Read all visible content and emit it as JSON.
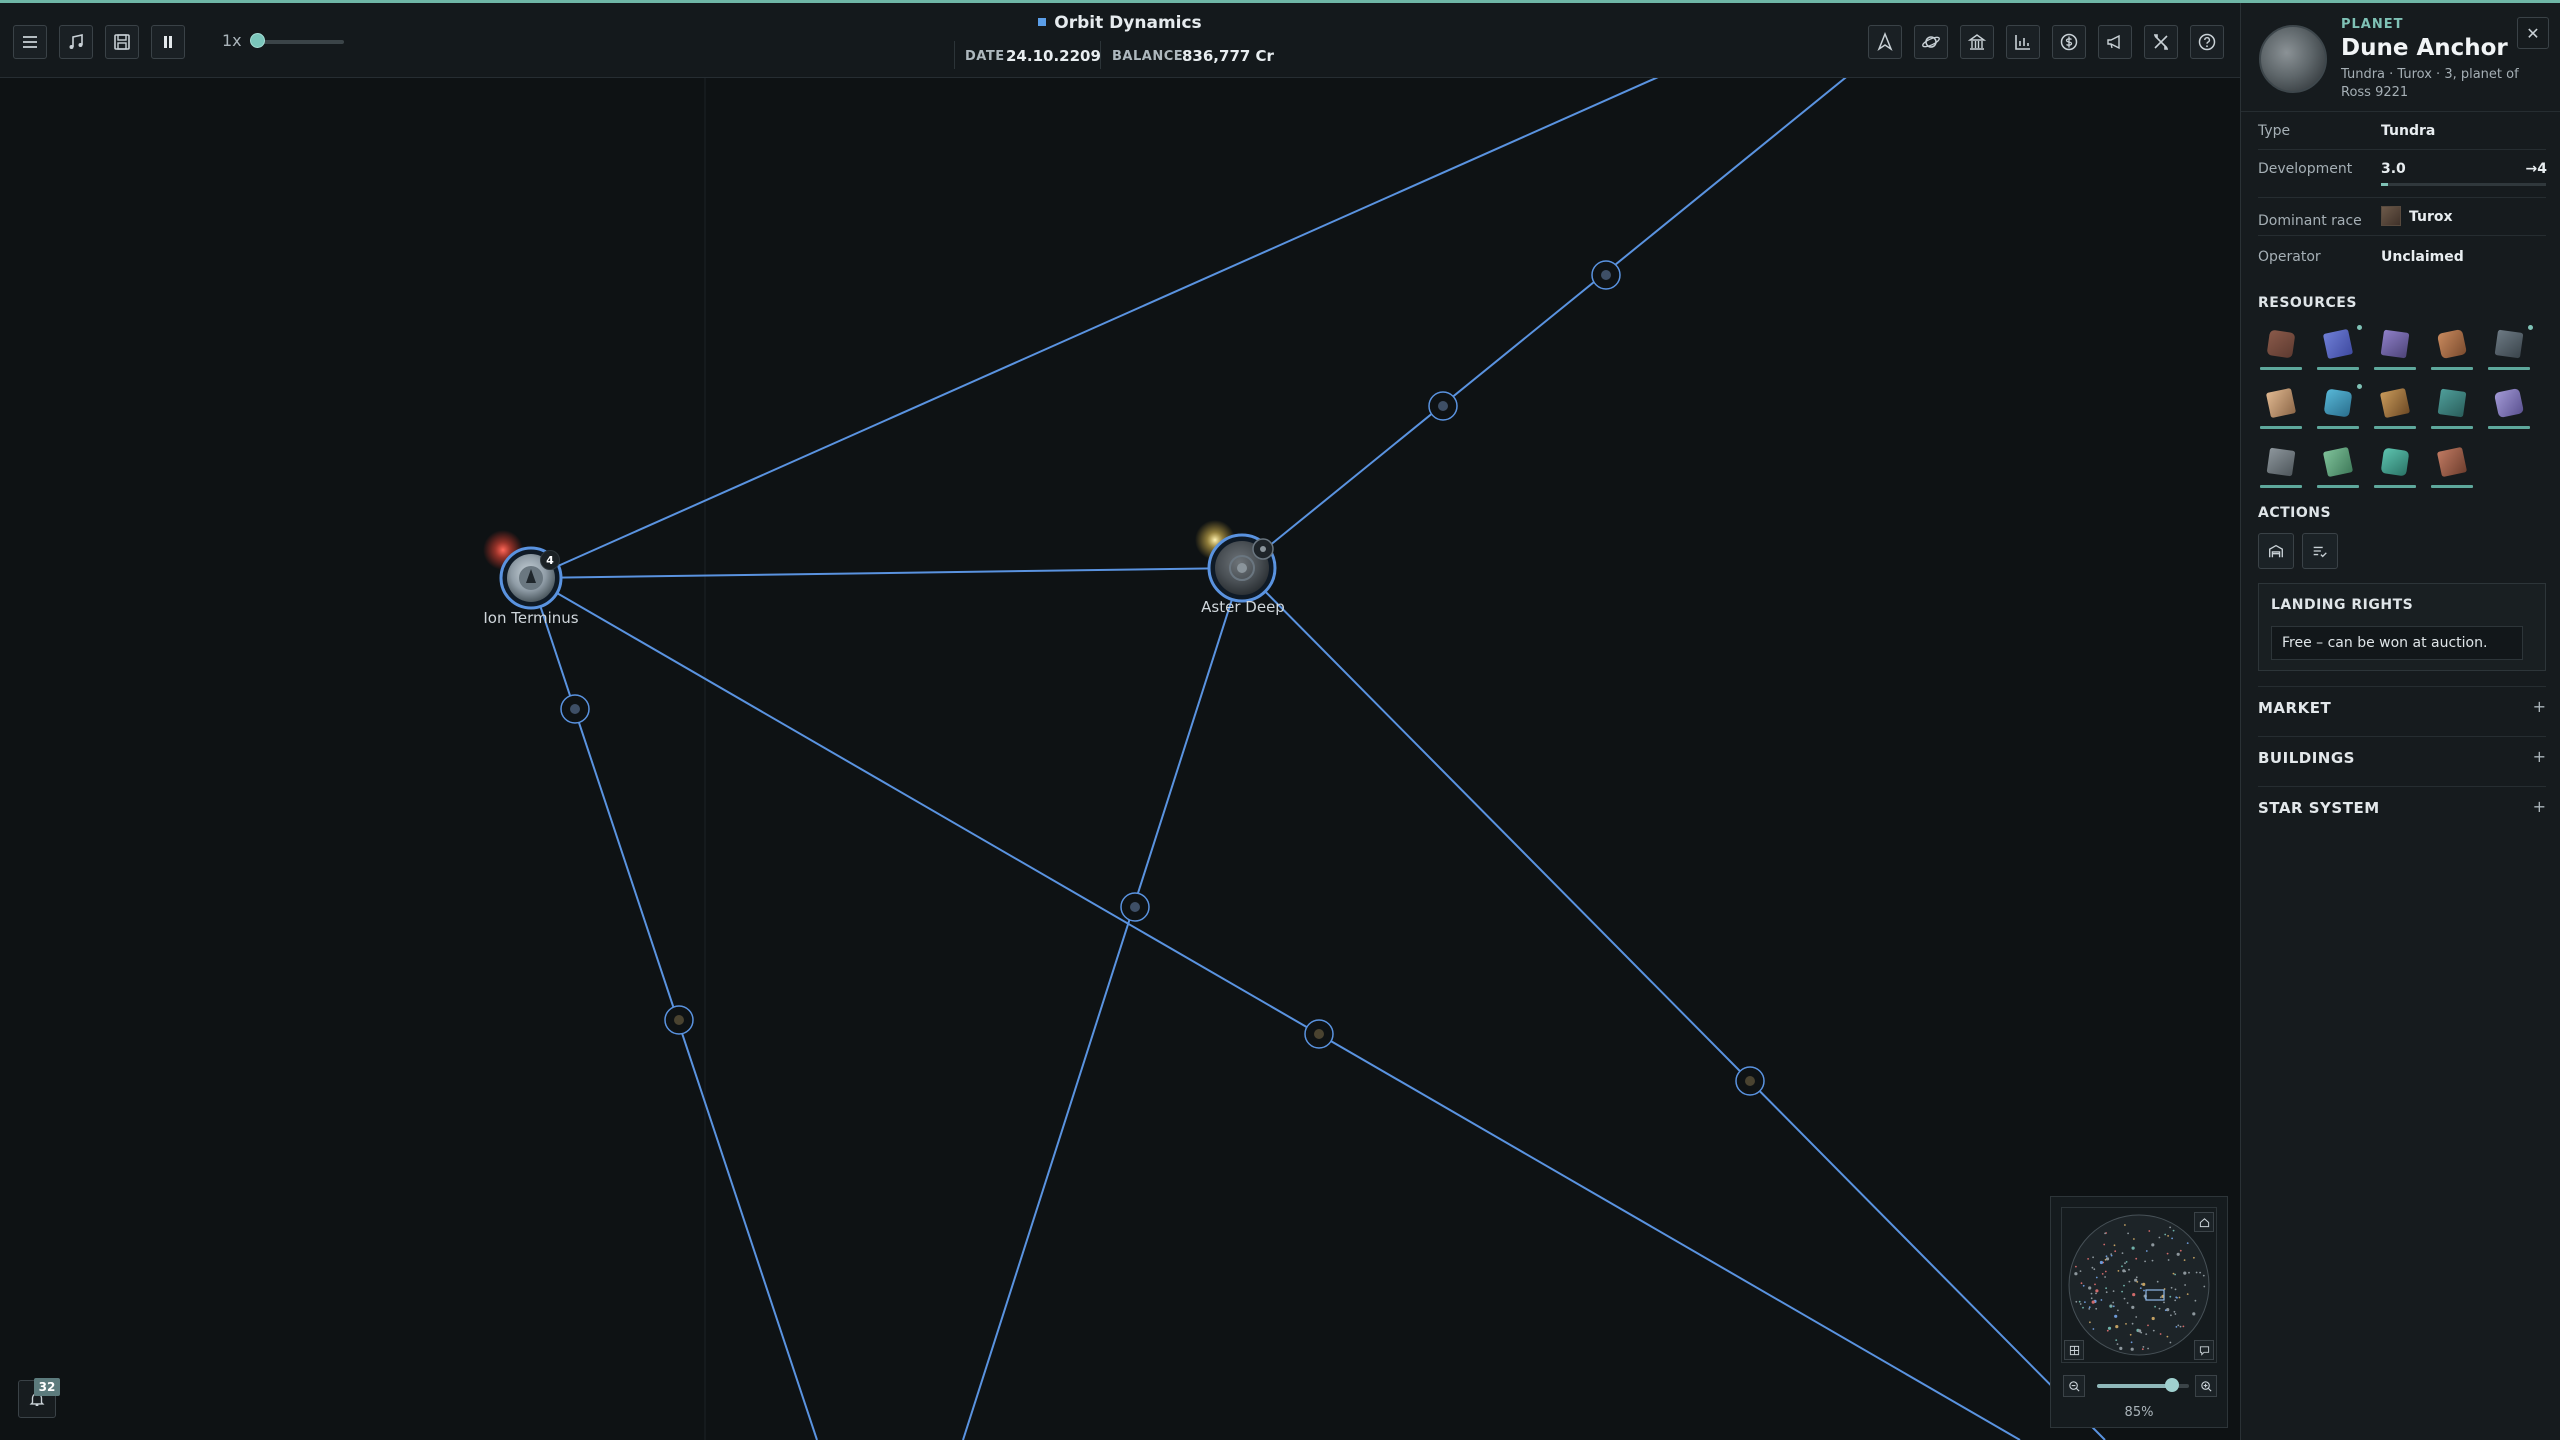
{
  "topbar": {
    "company": "Orbit Dynamics",
    "speed": "1x",
    "date_label": "DATE",
    "date_value": "24.10.2209",
    "balance_label": "BALANCE",
    "balance_value": "836,777 Cr",
    "left_buttons": [
      "menu-icon",
      "music-icon",
      "save-icon",
      "pause-icon"
    ],
    "right_buttons": [
      "ship-icon",
      "planet-icon",
      "bank-icon",
      "chart-icon",
      "money-icon",
      "megaphone-icon",
      "tools-icon",
      "help-icon"
    ]
  },
  "map": {
    "planets": [
      {
        "name": "Ion Terminus",
        "badge": "4"
      },
      {
        "name": "Aster Deep"
      }
    ]
  },
  "notifications": {
    "count": "32"
  },
  "minimap": {
    "zoom": "85%",
    "zoom_fraction": 0.82
  },
  "panel": {
    "kind": "PLANET",
    "name": "Dune Anchor",
    "subtitle": "Tundra · Turox · 3, planet of Ross 9221",
    "rows": {
      "type_label": "Type",
      "type_value": "Tundra",
      "dev_label": "Development",
      "dev_value": "3.0",
      "dev_next": "→4",
      "dev_fraction": 0.04,
      "race_label": "Dominant race",
      "race_value": "Turox",
      "operator_label": "Operator",
      "operator_value": "Unclaimed"
    },
    "resources_title": "RESOURCES",
    "actions_title": "ACTIONS",
    "landing_title": "LANDING RIGHTS",
    "landing_text": "Free – can be won at auction.",
    "sections": [
      "MARKET",
      "BUILDINGS",
      "STAR SYSTEM"
    ],
    "accent": "#7fc2b6",
    "route_color": "#5a93e0"
  }
}
